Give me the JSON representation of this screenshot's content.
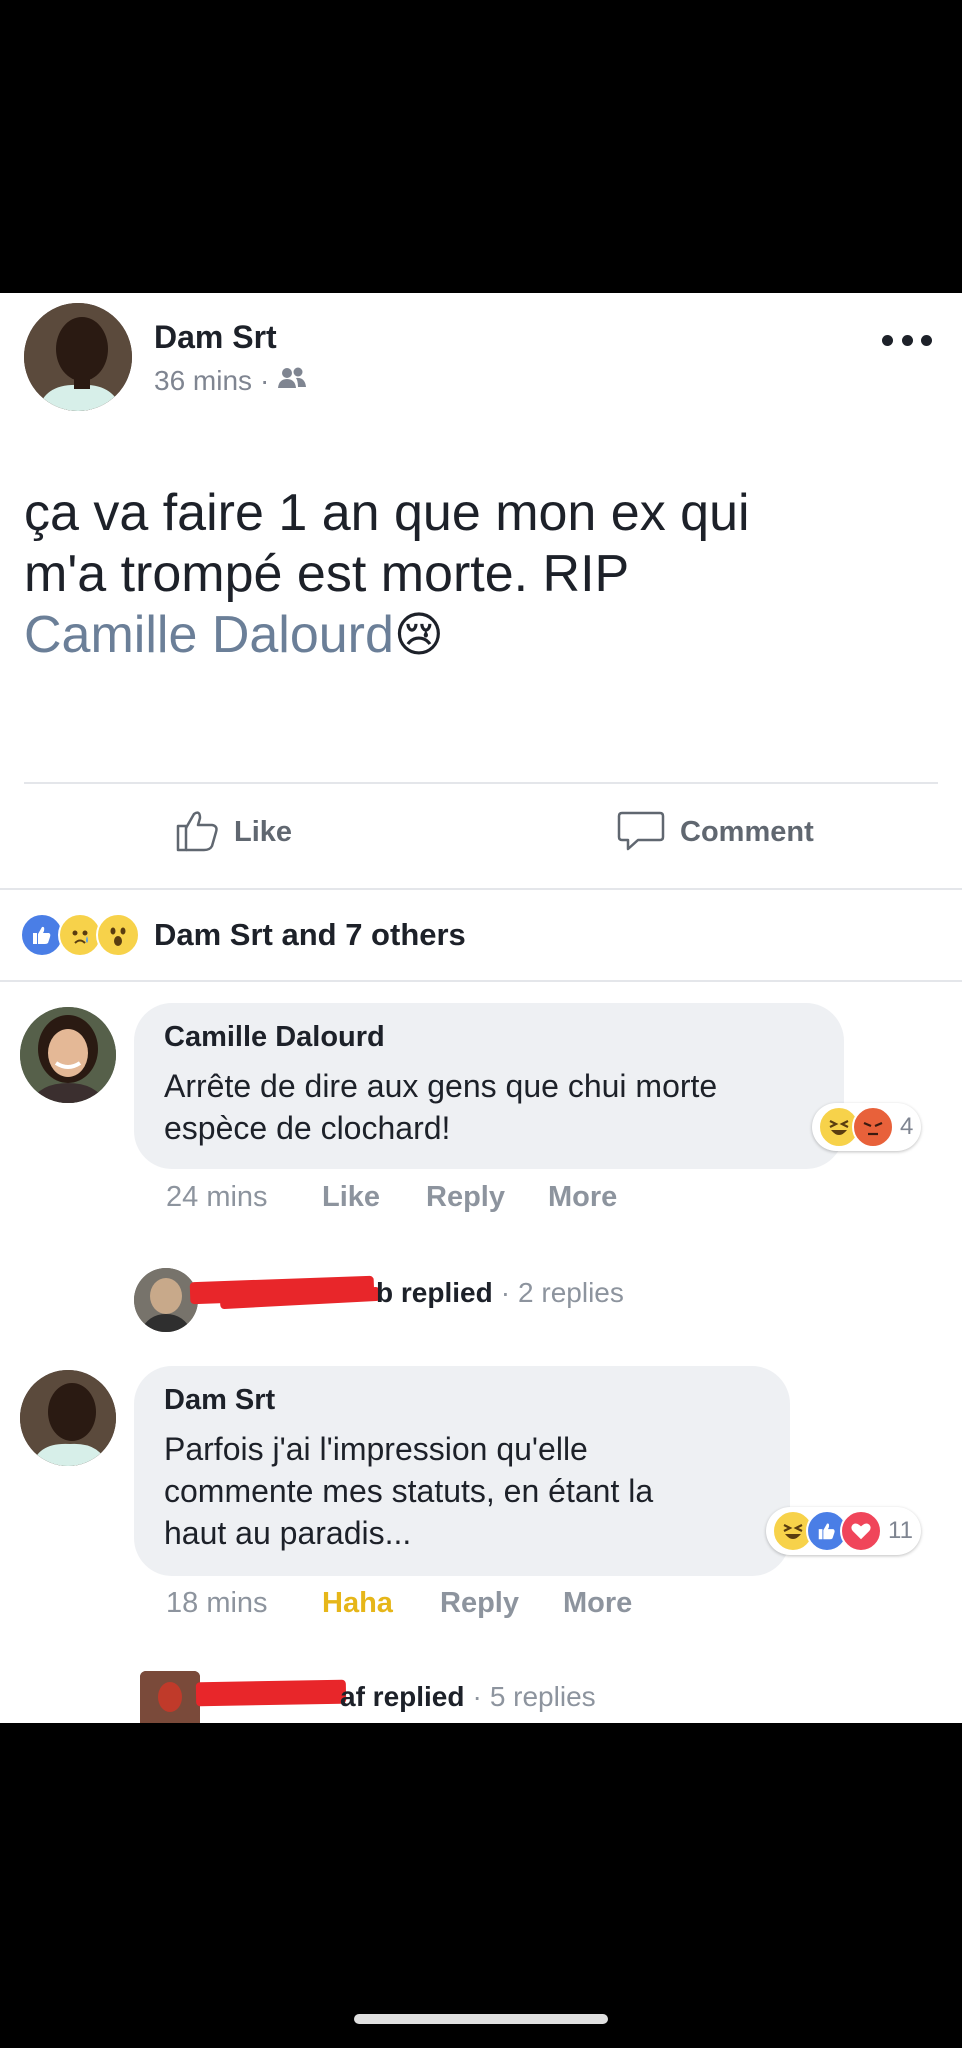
{
  "post": {
    "author": "Dam Srt",
    "time": "36 mins",
    "separator": "·",
    "text_line1": "ça va faire 1 an que mon ex qui",
    "text_line2": "m'a trompé est morte. RIP",
    "tagged_name": "Camille Dalourd",
    "emoji": "😢",
    "like_label": "Like",
    "comment_label": "Comment"
  },
  "reactions_summary": {
    "text": "Dam Srt and 7 others"
  },
  "comments": [
    {
      "author": "Camille Dalourd",
      "line1": "Arrête de dire aux gens que chui morte",
      "line2": "espèce de clochard!",
      "reaction_count": "4",
      "time": "24 mins",
      "like": "Like",
      "reply": "Reply",
      "more": "More",
      "replies_tail": "b replied",
      "replies_count": "2 replies"
    },
    {
      "author": "Dam Srt",
      "line1": "Parfois j'ai l'impression qu'elle",
      "line2": "commente mes statuts, en étant la",
      "line3": "haut au paradis...",
      "reaction_count": "11",
      "time": "18 mins",
      "like": "Haha",
      "reply": "Reply",
      "more": "More",
      "replies_tail": "af replied",
      "replies_count": "5 replies"
    }
  ],
  "colors": {
    "link": "#6b7f98",
    "haha_active": "#e6b619",
    "fb_blue": "#4a7ee6",
    "redaction": "#e8262a"
  }
}
